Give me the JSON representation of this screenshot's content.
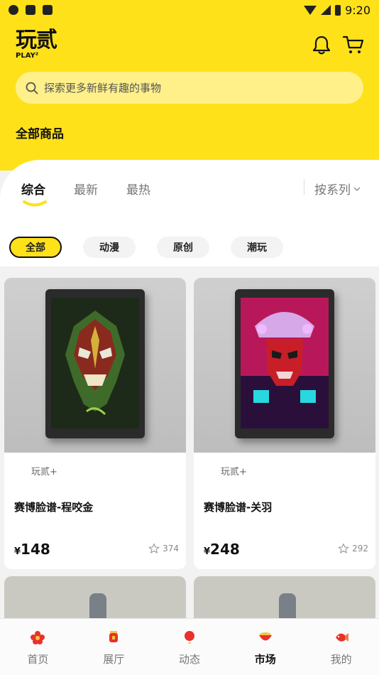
{
  "status_bar": {
    "time": "9:20"
  },
  "header": {
    "logo_text": "玩贰",
    "logo_subtext": "PLAY²",
    "search_placeholder": "探索更多新鲜有趣的事物",
    "section_title": "全部商品"
  },
  "tabs": [
    {
      "label": "综合",
      "active": true
    },
    {
      "label": "最新",
      "active": false
    },
    {
      "label": "最热",
      "active": false
    }
  ],
  "series_filter": "按系列",
  "chips": [
    {
      "label": "全部",
      "active": true
    },
    {
      "label": "动漫",
      "active": false
    },
    {
      "label": "原创",
      "active": false
    },
    {
      "label": "潮玩",
      "active": false
    }
  ],
  "products": [
    {
      "brand": "玩贰+",
      "name": "赛博脸谱-程咬金",
      "currency": "¥",
      "price": "148",
      "likes": "374"
    },
    {
      "brand": "玩贰+",
      "name": "赛博脸谱-关羽",
      "currency": "¥",
      "price": "248",
      "likes": "292"
    }
  ],
  "bottom_nav": [
    {
      "label": "首页",
      "icon": "flower-icon",
      "active": false
    },
    {
      "label": "展厅",
      "icon": "lantern-icon",
      "active": false
    },
    {
      "label": "动态",
      "icon": "balloon-icon",
      "active": false
    },
    {
      "label": "市场",
      "icon": "treasure-bowl-icon",
      "active": true
    },
    {
      "label": "我的",
      "icon": "koi-fish-icon",
      "active": false
    }
  ],
  "colors": {
    "brand_yellow": "#ffe11a",
    "search_bg": "#fff08a",
    "accent_red": "#e8322a"
  }
}
